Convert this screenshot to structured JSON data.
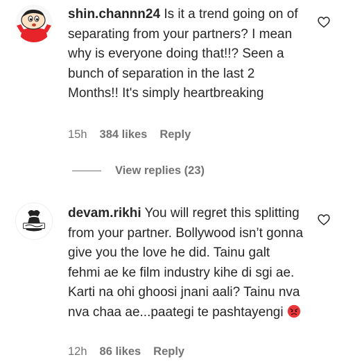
{
  "comments": [
    {
      "username": "shin.channn24",
      "text": "Is it a trend going on of separating from your partners? I mean why is everyone doing that!!? Seen a bunch of separation in the last 2 Months!! It's simply heartbreaking",
      "time": "15h",
      "likes": "384 likes",
      "reply_label": "Reply",
      "avatar_icon": "shinchan-avatar-icon"
    },
    {
      "username": "devam.rikhi",
      "text": "You will regret this splitting from your partner. Bollywood isn’t gonna give you the love he did. Tainu galt fehmi ae ke film industry kihe di sgi ae. Karti na ohi ghoosi jnani aali? Tainu nva nva chaa ae...paategi te pashtayengi",
      "time": "12h",
      "likes": "86 likes",
      "reply_label": "Reply",
      "avatar_icon": "devam-logo-avatar-icon"
    }
  ],
  "view_replies": "View replies (23)",
  "colors": {
    "text": "#262626",
    "secondary": "#737373",
    "emoji_red": "#e8373a"
  }
}
